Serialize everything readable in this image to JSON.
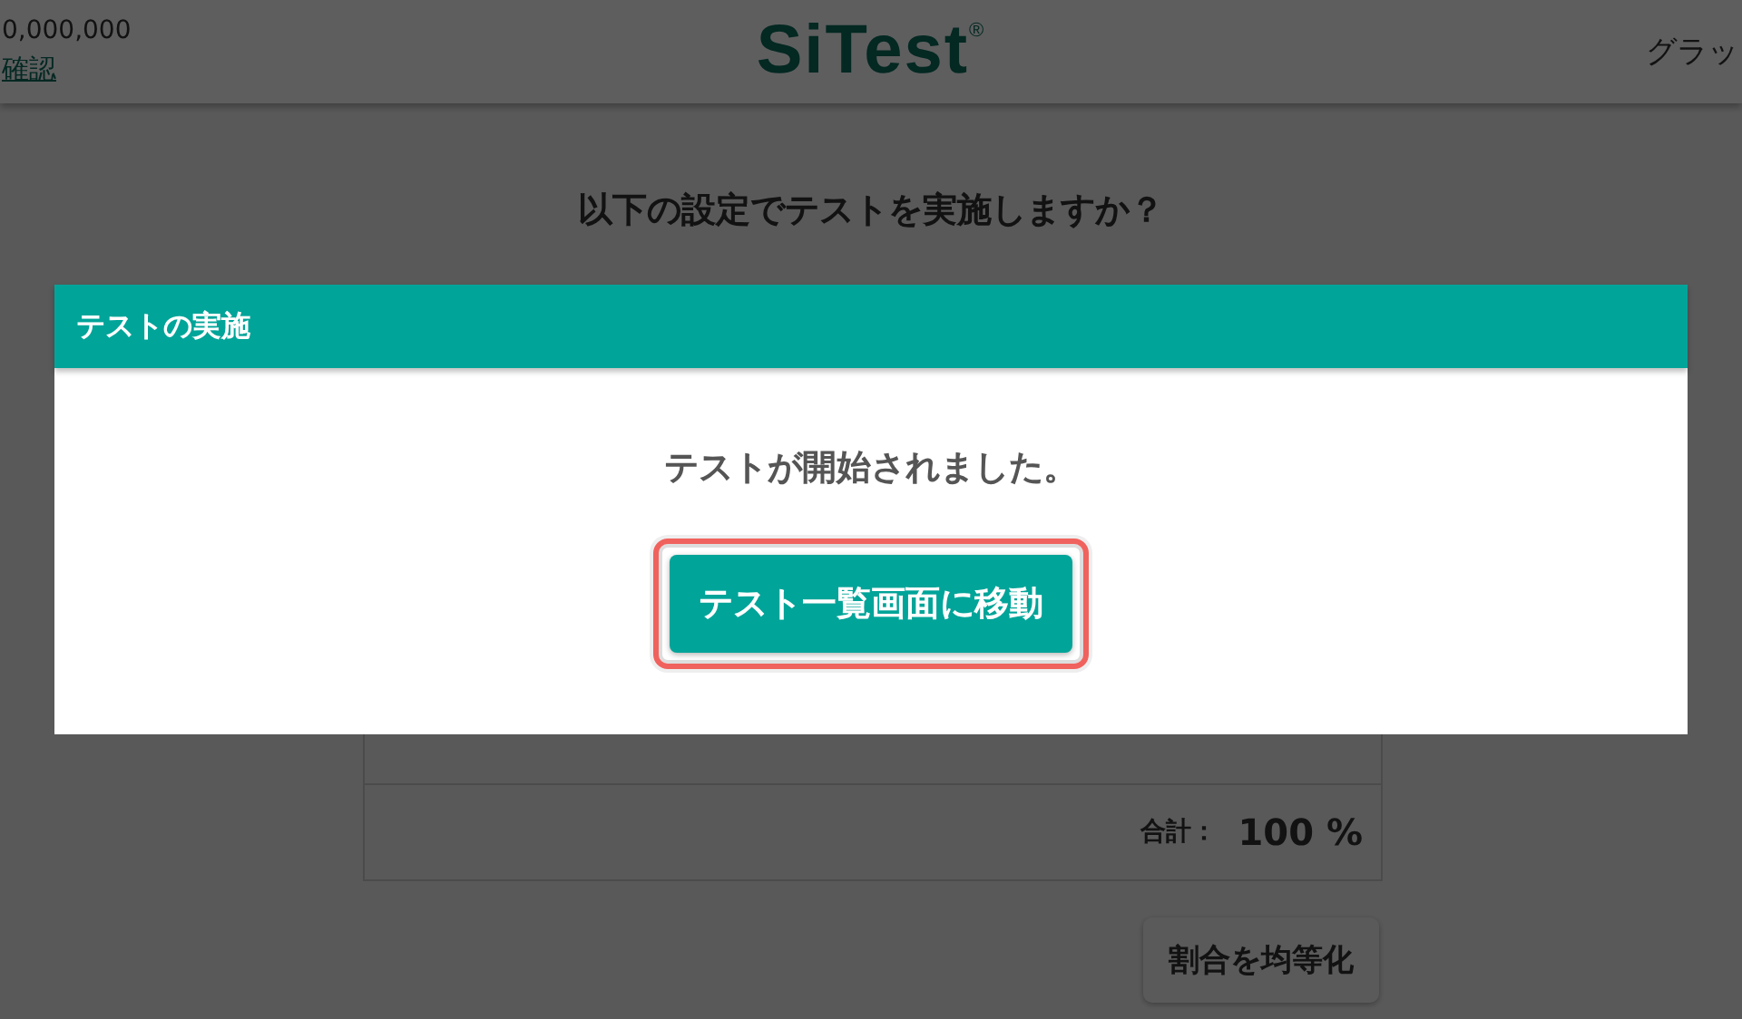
{
  "header": {
    "budget": "0,000,000",
    "confirm_link": "確認",
    "logo": "SiTest",
    "logo_mark": "®",
    "right_menu": "グラッ"
  },
  "page": {
    "question": "以下の設定でテストを実施しますか？",
    "total_label": "合計：",
    "total_value": "100 %",
    "equalize_button": "割合を均等化"
  },
  "modal": {
    "title": "テストの実施",
    "message": "テストが開始されました。",
    "button": "テスト一覧画面に移動",
    "highlighted": true
  }
}
